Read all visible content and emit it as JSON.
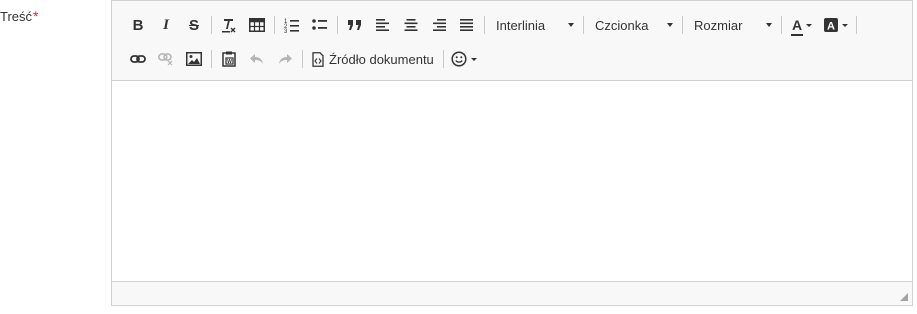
{
  "field": {
    "label": "Treść",
    "required_mark": "*"
  },
  "toolbar": {
    "line_height": {
      "label": "Interlinia"
    },
    "font": {
      "label": "Czcionka"
    },
    "size": {
      "label": "Rozmiar"
    },
    "source": {
      "label": "Źródło dokumentu"
    },
    "icons": {
      "bold": "B",
      "italic": "I",
      "strike": "S"
    }
  },
  "content": {
    "text": ""
  },
  "colors": {
    "border": "#d1d1d1",
    "toolbar_bg": "#f8f8f8",
    "required": "#d9232d",
    "icon": "#333333",
    "icon_disabled": "#b5b5b5"
  }
}
